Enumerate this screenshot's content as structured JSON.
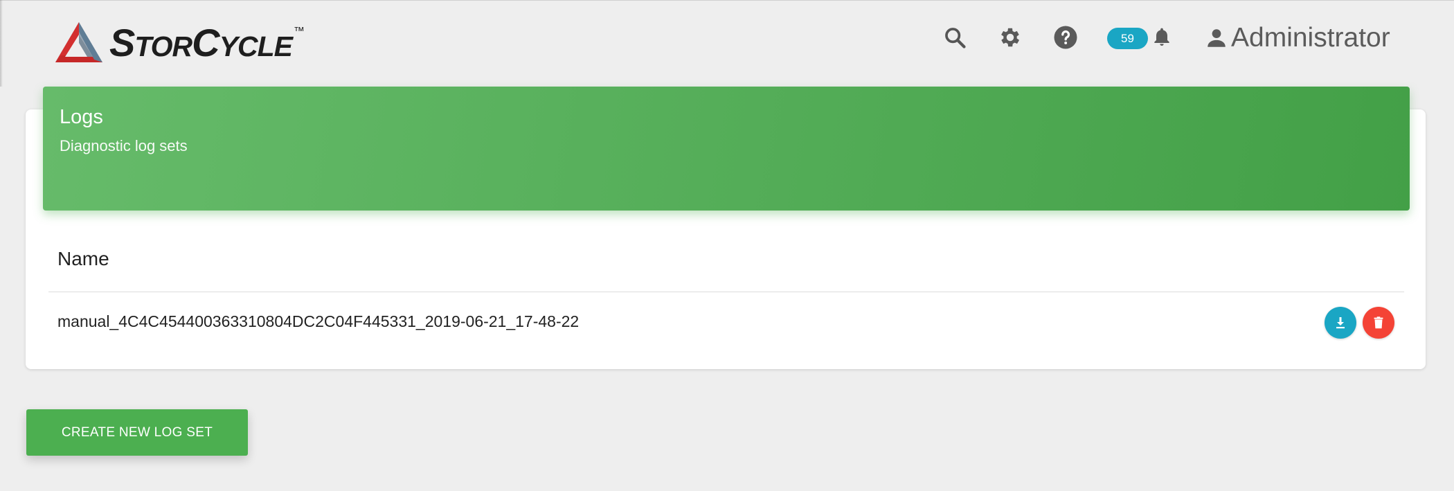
{
  "app": {
    "logo": {
      "brand_initial_1": "S",
      "brand_rest_1": "tor",
      "brand_initial_2": "C",
      "brand_rest_2": "ycle",
      "trademark": "™"
    }
  },
  "header": {
    "icons": [
      "search-icon",
      "gear-icon",
      "help-icon",
      "bell-icon",
      "user-icon"
    ],
    "notification_count": "59",
    "user_name": "Administrator"
  },
  "card": {
    "title": "Logs",
    "subtitle": "Diagnostic log sets",
    "table": {
      "columns": [
        "Name"
      ],
      "rows": [
        {
          "name": "manual_4C4C454400363310804DC2C04F445331_2019-06-21_17-48-22"
        }
      ]
    }
  },
  "actions": {
    "create_label": "CREATE NEW LOG SET"
  },
  "colors": {
    "accent_green": "#4caf50",
    "header_gradient_start": "#66bb6a",
    "header_gradient_end": "#43a047",
    "badge_teal": "#1aa6c4",
    "delete_red": "#f44336",
    "background": "#eeeeee"
  }
}
